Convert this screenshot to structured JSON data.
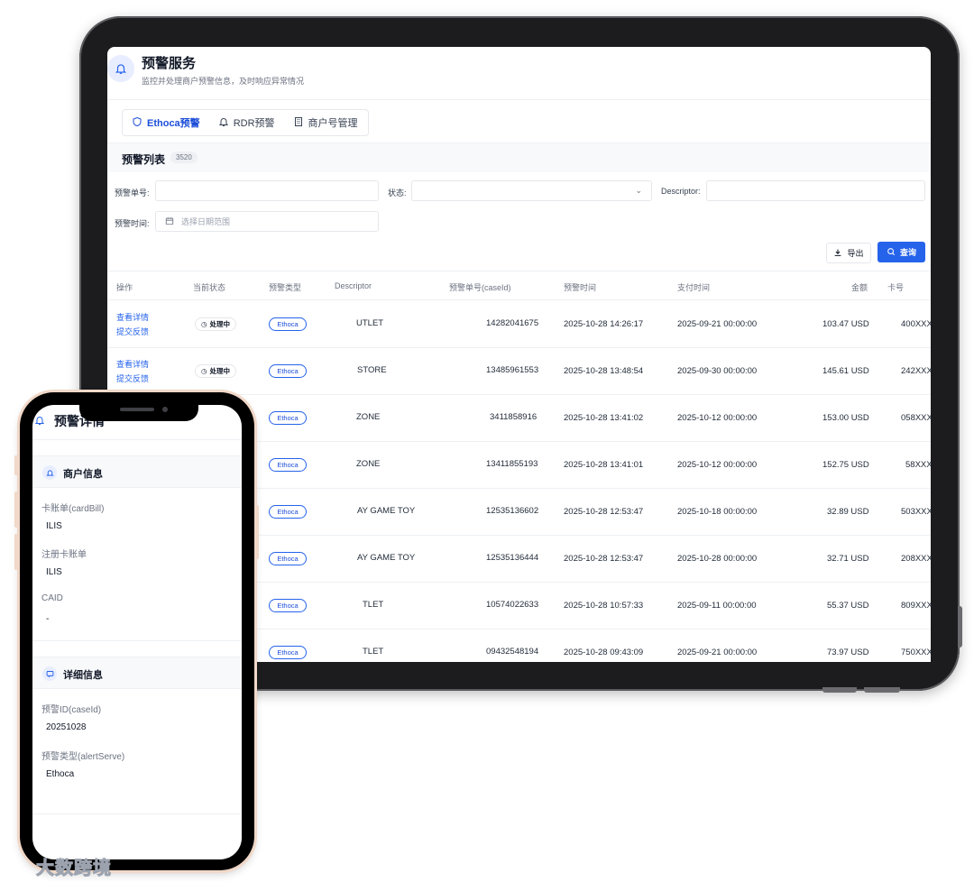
{
  "header": {
    "title": "预警服务",
    "subtitle": "监控并处理商户预警信息，及时响应异常情况"
  },
  "tabs": [
    {
      "label": "Ethoca预警",
      "icon": "shield-icon",
      "active": true
    },
    {
      "label": "RDR预警",
      "icon": "bell-icon",
      "active": false
    },
    {
      "label": "商户号管理",
      "icon": "building-icon",
      "active": false
    }
  ],
  "list": {
    "title": "预警列表",
    "count": "3520"
  },
  "filters": {
    "alert_no_label": "预警单号:",
    "status_label": "状态:",
    "descriptor_label": "Descriptor:",
    "time_label": "预警时间:",
    "time_placeholder": "选择日期范围"
  },
  "actions": {
    "export": "导出",
    "query": "查询"
  },
  "columns": [
    "操作",
    "当前状态",
    "预警类型",
    "Descriptor",
    "预警单号(caseId)",
    "预警时间",
    "支付时间",
    "金额",
    "卡号"
  ],
  "row_actions": {
    "view": "查看详情",
    "feedback": "提交反馈"
  },
  "rows": [
    {
      "status": "处理中",
      "type": "Ethoca",
      "descriptor": "UTLET",
      "case_id": "14282041675",
      "alert_time": "2025-10-28 14:26:17",
      "pay_time": "2025-09-21 00:00:00",
      "amount": "103.47 USD",
      "card": "400XXX"
    },
    {
      "status": "处理中",
      "type": "Ethoca",
      "descriptor": "STORE",
      "case_id": "13485961553",
      "alert_time": "2025-10-28 13:48:54",
      "pay_time": "2025-09-30 00:00:00",
      "amount": "145.61 USD",
      "card": "242XXX"
    },
    {
      "status": "",
      "type": "Ethoca",
      "descriptor": "ZONE",
      "case_id": "3411858916",
      "alert_time": "2025-10-28 13:41:02",
      "pay_time": "2025-10-12 00:00:00",
      "amount": "153.00 USD",
      "card": "058XXX"
    },
    {
      "status": "",
      "type": "Ethoca",
      "descriptor": "ZONE",
      "case_id": "13411855193",
      "alert_time": "2025-10-28 13:41:01",
      "pay_time": "2025-10-12 00:00:00",
      "amount": "152.75 USD",
      "card": "58XXX"
    },
    {
      "status": "",
      "type": "Ethoca",
      "descriptor": "AY GAME TOY",
      "case_id": "12535136602",
      "alert_time": "2025-10-28 12:53:47",
      "pay_time": "2025-10-18 00:00:00",
      "amount": "32.89 USD",
      "card": "503XXX"
    },
    {
      "status": "",
      "type": "Ethoca",
      "descriptor": "AY GAME TOY",
      "case_id": "12535136444",
      "alert_time": "2025-10-28 12:53:47",
      "pay_time": "2025-10-28 00:00:00",
      "amount": "32.71 USD",
      "card": "208XXX"
    },
    {
      "status": "",
      "type": "Ethoca",
      "descriptor": "TLET",
      "case_id": "10574022633",
      "alert_time": "2025-10-28 10:57:33",
      "pay_time": "2025-09-11 00:00:00",
      "amount": "55.37 USD",
      "card": "809XXX"
    },
    {
      "status": "",
      "type": "Ethoca",
      "descriptor": "TLET",
      "case_id": "09432548194",
      "alert_time": "2025-10-28 09:43:09",
      "pay_time": "2025-09-21 00:00:00",
      "amount": "73.97 USD",
      "card": "750XXX"
    }
  ],
  "phone": {
    "title": "预警详情",
    "merchant_section": "商户信息",
    "detail_section": "详细信息",
    "fields": [
      {
        "label": "卡账单(cardBill)",
        "value": "ILIS"
      },
      {
        "label": "注册卡账单",
        "value": "ILIS"
      },
      {
        "label": "CAID",
        "value": "-"
      }
    ],
    "detail_fields": [
      {
        "label": "预警ID(caseId)",
        "value": "20251028"
      },
      {
        "label": "预警类型(alertServe)",
        "value": "Ethoca"
      }
    ]
  },
  "watermark": "大数跨境",
  "colors": {
    "primary": "#2563eb",
    "tablet_frame": "#1c1c1e",
    "phone_frame": "#f1d8c8"
  }
}
